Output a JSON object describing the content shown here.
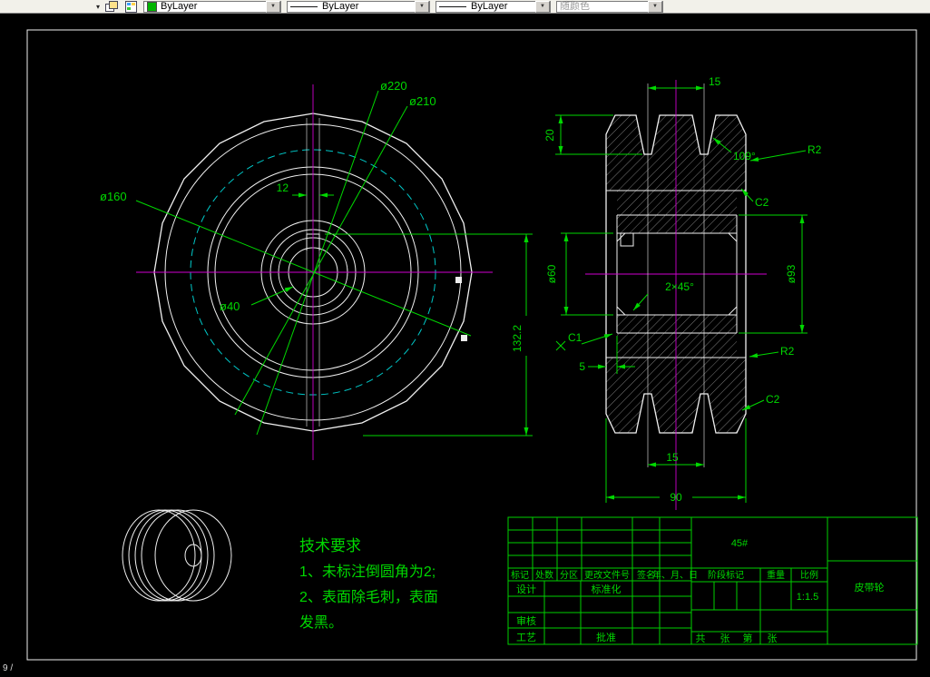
{
  "toolbar": {
    "icons": {
      "dropdown_arrow": "▼",
      "overflow_arrow": "▾"
    },
    "combos": [
      {
        "name": "color",
        "label": "ByLayer",
        "swatch_color": "#00b400"
      },
      {
        "name": "linetype",
        "label": "ByLayer"
      },
      {
        "name": "lineweight",
        "label": "ByLayer"
      },
      {
        "name": "plot_style",
        "label": "随颜色"
      }
    ]
  },
  "front_view": {
    "dims": {
      "d220": "ø220",
      "d210": "ø210",
      "d160": "ø160",
      "d40": "ø40",
      "key_width": "12",
      "height": "132.2"
    }
  },
  "section_view": {
    "dims": {
      "groove_pitch_top": "15",
      "rim_h": "20",
      "groove_angle": "109°",
      "r2_top": "R2",
      "c2_top": "C2",
      "bore": "ø60",
      "hub": "ø93",
      "bore_chamfer": "2×45°",
      "c1": "C1",
      "hub_offset": "5",
      "r2_bottom": "R2",
      "c2_bottom": "C2",
      "groove_pitch_bottom": "15",
      "width": "90"
    }
  },
  "tech_req": {
    "title": "技术要求",
    "line1": "1、未标注倒圆角为2;",
    "line2": "2、表面除毛刺，表面",
    "line3": "发黑。"
  },
  "title_block": {
    "material": "45#",
    "part_name": "皮带轮",
    "scale_value": "1:1.5",
    "labels": {
      "mark": "标记",
      "count": "处数",
      "zone": "分区",
      "change_no": "更改文件号",
      "sign": "签名",
      "date": "年、月、日",
      "design": "设计",
      "standard": "标准化",
      "check": "审核",
      "process": "工艺",
      "approve": "批准",
      "stage": "阶段标记",
      "weight": "重量",
      "scale": "比例"
    },
    "sheet": {
      "total": "共",
      "sheets": "张",
      "no": "第",
      "sheet": "张"
    }
  },
  "statusbar": {
    "fragment": "9 /"
  }
}
